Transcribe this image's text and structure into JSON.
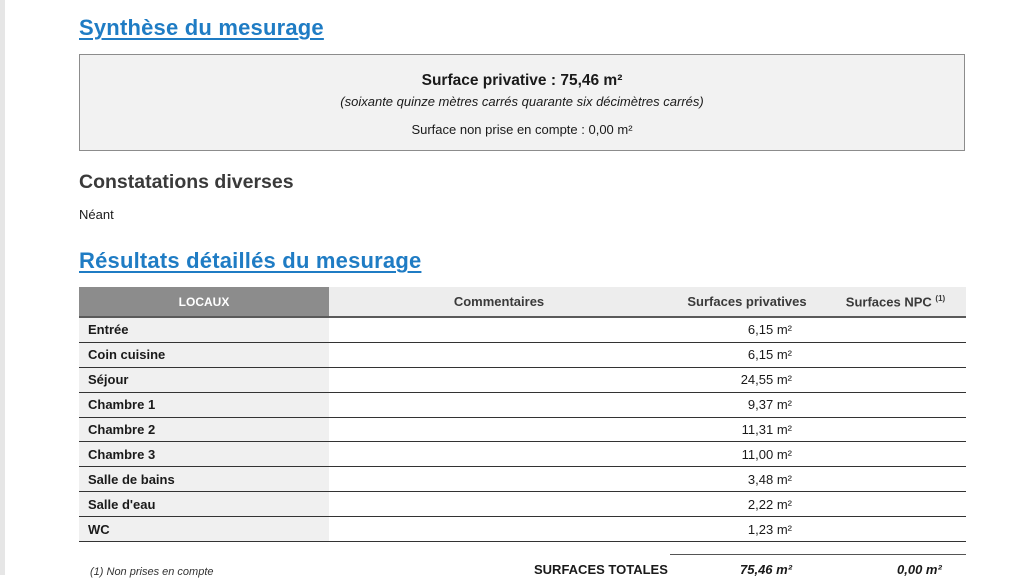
{
  "synthese": {
    "title": "Synthèse du mesurage",
    "surface_privative": "Surface privative : 75,46 m²",
    "surface_words": "(soixante quinze  mètres carrés quarante  six  décimètres carrés)",
    "surface_npc": "Surface non prise en compte : 0,00 m²"
  },
  "constatations": {
    "title": "Constatations diverses",
    "text": "Néant"
  },
  "resultats": {
    "title": "Résultats détaillés du mesurage",
    "columns": {
      "locaux": "LOCAUX",
      "commentaires": "Commentaires",
      "surfaces_privatives": "Surfaces privatives",
      "surfaces_npc": "Surfaces NPC",
      "npc_note": "(1)"
    },
    "rows": [
      {
        "local": "Entrée",
        "commentaire": "",
        "surface": "6,15 m²",
        "npc": ""
      },
      {
        "local": "Coin cuisine",
        "commentaire": "",
        "surface": "6,15 m²",
        "npc": ""
      },
      {
        "local": "Séjour",
        "commentaire": "",
        "surface": "24,55 m²",
        "npc": ""
      },
      {
        "local": "Chambre 1",
        "commentaire": "",
        "surface": "9,37 m²",
        "npc": ""
      },
      {
        "local": "Chambre 2",
        "commentaire": "",
        "surface": "11,31 m²",
        "npc": ""
      },
      {
        "local": "Chambre 3",
        "commentaire": "",
        "surface": "11,00 m²",
        "npc": ""
      },
      {
        "local": "Salle de bains",
        "commentaire": "",
        "surface": "3,48 m²",
        "npc": ""
      },
      {
        "local": "Salle d'eau",
        "commentaire": "",
        "surface": "2,22 m²",
        "npc": ""
      },
      {
        "local": "WC",
        "commentaire": "",
        "surface": "1,23 m²",
        "npc": ""
      }
    ],
    "footnote": "(1)  Non prises en compte",
    "totals": {
      "label": "SURFACES TOTALES",
      "privatives": "75,46 m²",
      "npc": "0,00 m²"
    }
  }
}
